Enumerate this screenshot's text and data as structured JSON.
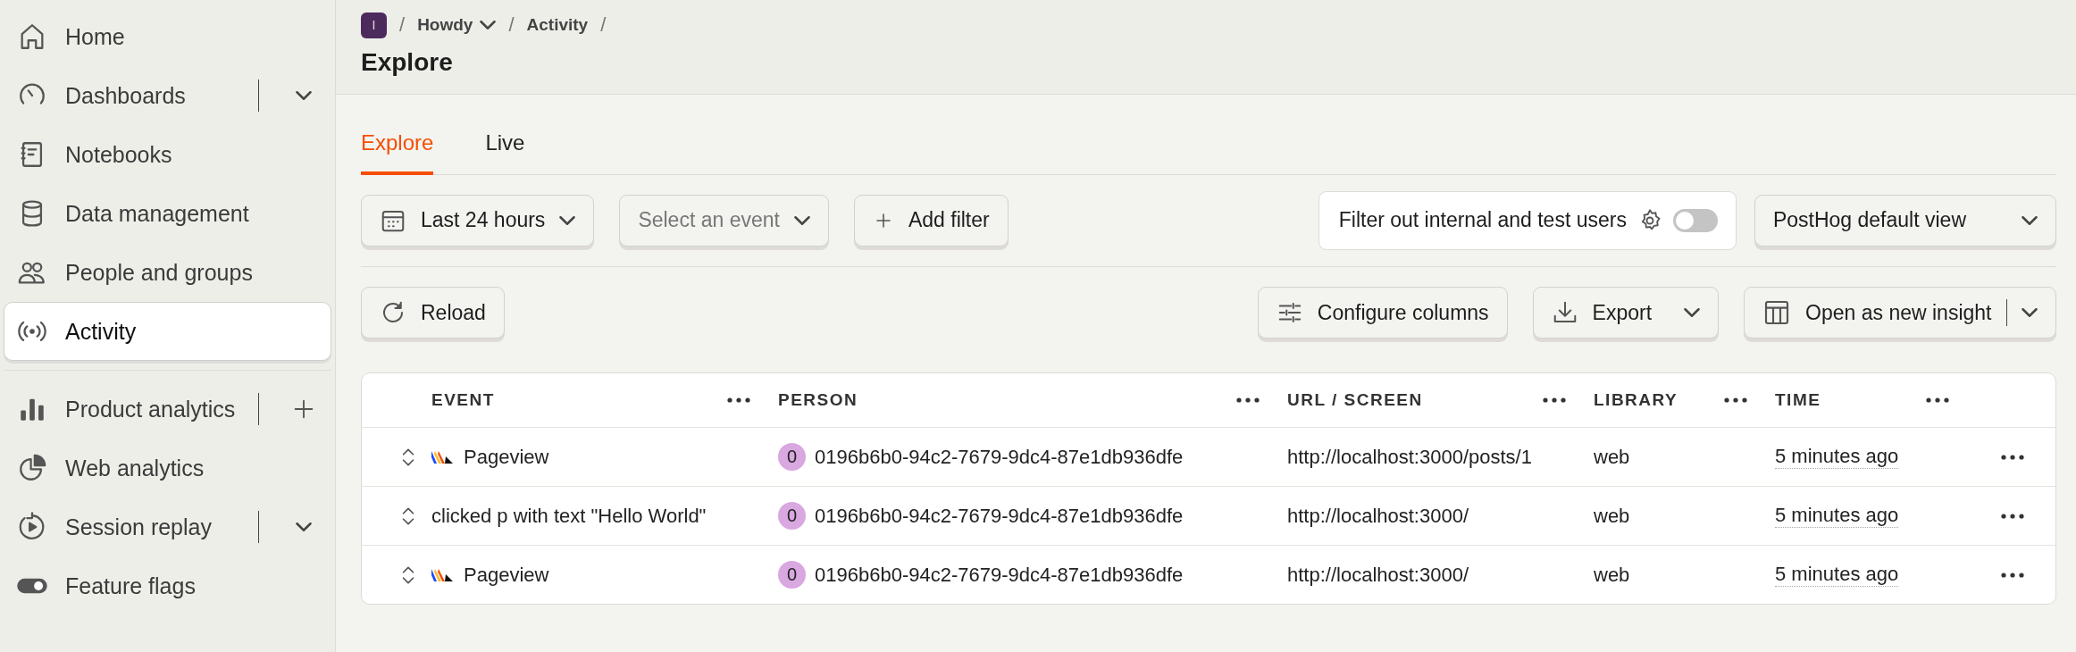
{
  "sidebar": {
    "items": [
      {
        "label": "Home",
        "selected": false,
        "kind": "plain"
      },
      {
        "label": "Dashboards",
        "selected": false,
        "kind": "dropdown"
      },
      {
        "label": "Notebooks",
        "selected": false,
        "kind": "plain"
      },
      {
        "label": "Data management",
        "selected": false,
        "kind": "plain"
      },
      {
        "label": "People and groups",
        "selected": false,
        "kind": "plain"
      },
      {
        "label": "Activity",
        "selected": true,
        "kind": "plain"
      },
      {
        "label": "Product analytics",
        "selected": false,
        "kind": "add"
      },
      {
        "label": "Web analytics",
        "selected": false,
        "kind": "plain"
      },
      {
        "label": "Session replay",
        "selected": false,
        "kind": "dropdown"
      },
      {
        "label": "Feature flags",
        "selected": false,
        "kind": "plain"
      }
    ]
  },
  "breadcrumbs": [
    {
      "label": "Howdy",
      "kind": "project",
      "badge": "I",
      "separator_before": "/",
      "separator_after": "/"
    },
    {
      "label": "Activity",
      "kind": "link",
      "separator_after": "/"
    }
  ],
  "title": "Explore",
  "tabs": [
    {
      "label": "Explore",
      "selected": true
    },
    {
      "label": "Live",
      "selected": false
    }
  ],
  "filters": {
    "date_range": "Last 24 hours",
    "event_select": {
      "placeholder": "Select an event"
    },
    "add_filter": "Add filter",
    "test_users": {
      "label": "Filter out internal and test users",
      "on": false
    },
    "view": "PostHog default view"
  },
  "toolbar": {
    "reload": "Reload",
    "configure_columns": "Configure columns",
    "export": "Export",
    "open_insight": "Open as new insight"
  },
  "table": {
    "columns": [
      "EVENT",
      "PERSON",
      "URL / SCREEN",
      "LIBRARY",
      "TIME"
    ],
    "rows": [
      {
        "kind": "pageview",
        "event": "Pageview",
        "person_initial": "0",
        "person": "0196b6b0-94c2-7679-9dc4-87e1db936dfe",
        "url": "http://localhost:3000/posts/1",
        "library": "web",
        "time": "5 minutes ago"
      },
      {
        "kind": "autocapture",
        "event": "clicked p with text \"Hello World\"",
        "person_initial": "0",
        "person": "0196b6b0-94c2-7679-9dc4-87e1db936dfe",
        "url": "http://localhost:3000/",
        "library": "web",
        "time": "5 minutes ago"
      },
      {
        "kind": "pageview",
        "event": "Pageview",
        "person_initial": "0",
        "person": "0196b6b0-94c2-7679-9dc4-87e1db936dfe",
        "url": "http://localhost:3000/",
        "library": "web",
        "time": "5 minutes ago"
      }
    ]
  }
}
